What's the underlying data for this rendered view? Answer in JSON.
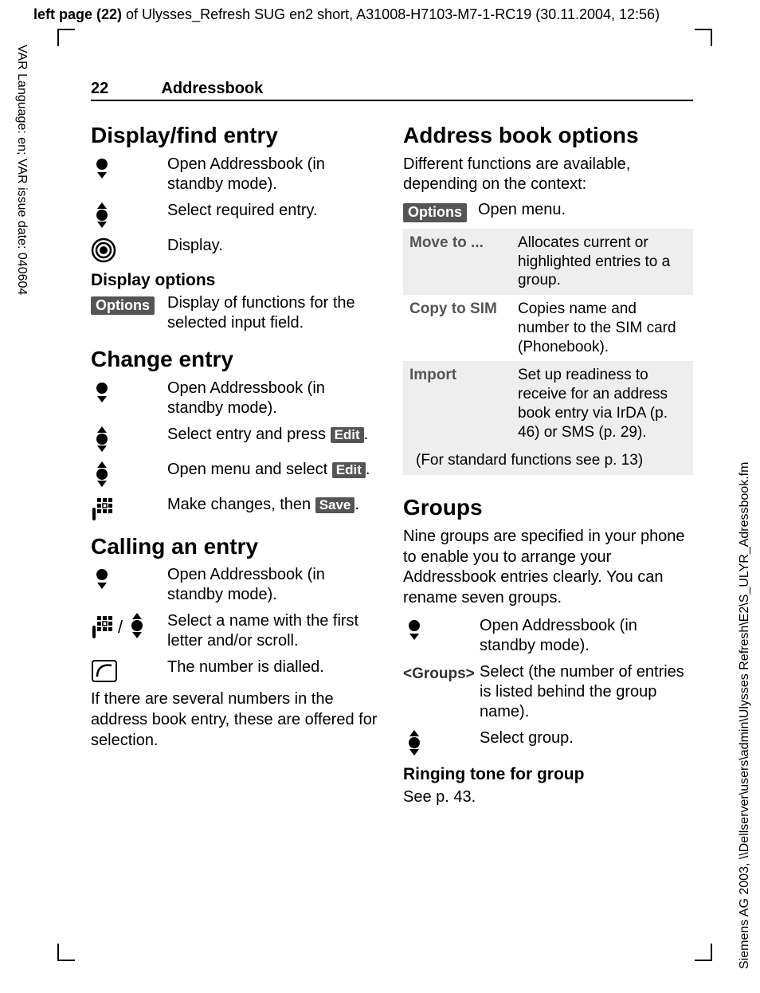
{
  "meta": {
    "header_bold": "left page (22)",
    "header_rest": " of Ulysses_Refresh SUG en2 short, A31008-H7103-M7-1-RC19 (30.11.2004, 12:56)",
    "side_left": "VAR Language: en; VAR issue date: 040604",
    "side_right": "Siemens AG 2003, \\\\Dellserver\\users\\admin\\Ulysses Refresh\\E2\\S_ULYR_Adressbook.fm"
  },
  "running_head": {
    "page": "22",
    "title": "Addressbook"
  },
  "softkeys": {
    "options": "Options",
    "edit": "Edit",
    "save": "Save"
  },
  "left": {
    "sec1": {
      "title": "Display/find entry",
      "e1": "Open Addressbook (in standby mode).",
      "e2": "Select required entry.",
      "e3": "Display.",
      "sub": "Display options",
      "opt_text": "Display of functions for the selected input field."
    },
    "sec2": {
      "title": "Change entry",
      "e1": "Open Addressbook (in standby mode).",
      "e2a": "Select entry and press ",
      "e2b": ".",
      "e3a": "Open menu and select ",
      "e3b": ".",
      "e4a": "Make changes, then ",
      "e4b": "."
    },
    "sec3": {
      "title": "Calling an entry",
      "e1": "Open Addressbook (in standby mode).",
      "e2": "Select a name with the first letter and/or scroll.",
      "e3": "The number is dialled.",
      "tail": "If there are several numbers in the address book entry, these are offered for selection."
    }
  },
  "right": {
    "sec1": {
      "title": "Address book options",
      "intro": "Different functions are available, depending on the context:",
      "open_menu": "Open menu.",
      "rows": {
        "r1k": "Move to ...",
        "r1v": "Allocates current or highlighted entries to a group.",
        "r2k": "Copy to SIM",
        "r2v": "Copies name and number to the SIM card (Phonebook).",
        "r3k": "Import",
        "r3v": "Set up readiness to receive for an address book entry via IrDA (p. 46) or SMS (p. 29)."
      },
      "footer": "(For standard functions see p. 13)"
    },
    "sec2": {
      "title": "Groups",
      "intro": "Nine groups are specified in your phone to enable you to arrange your Addressbook entries clearly. You can rename seven groups.",
      "e1": "Open Addressbook (in standby mode).",
      "g_tag": "<Groups>",
      "e2": "Select (the number of entries is listed behind the group name).",
      "e3": "Select group.",
      "sub": "Ringing tone for group",
      "see": "See p. 43."
    }
  }
}
